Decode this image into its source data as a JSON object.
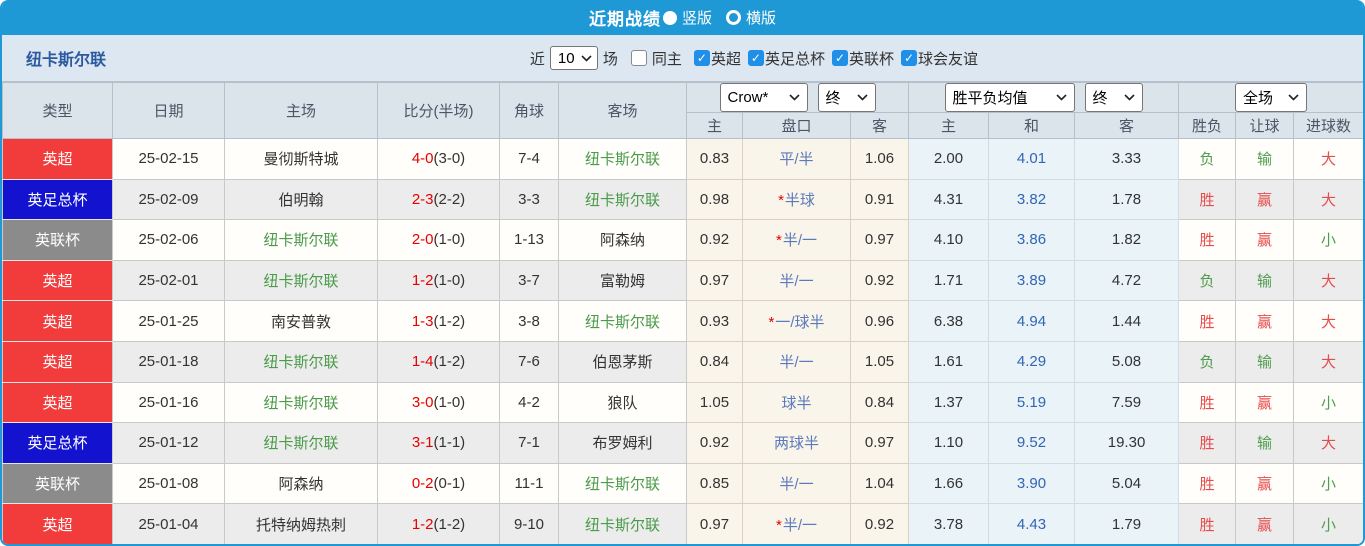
{
  "colors": {
    "accent": "#1f98d6",
    "filter-bg": "#dde7f1",
    "header-bg": "#dce4eb",
    "check-blue": "#1f8fe8",
    "team-link": "#2c5aa0",
    "newcastle-green": "#4a9b4a",
    "score-red": "#e60000",
    "handicap-blue": "#5b79bb",
    "draw-blue": "#3265b4",
    "crow-bg": "#faf5eb",
    "avg-bg": "#e9f3f8",
    "row-odd-bg": "#fffefa",
    "row-even-bg": "#ececec"
  },
  "titlebar": {
    "title": "近期战绩",
    "radio_vertical": "竖版",
    "radio_horizontal": "横版"
  },
  "filterbar": {
    "team": "纽卡斯尔联",
    "recent_label": "近",
    "recent_value": "10",
    "matches_label": "场",
    "same_home_label": "同主",
    "same_home_checked": false,
    "leagues": [
      {
        "label": "英超",
        "checked": true
      },
      {
        "label": "英足总杯",
        "checked": true
      },
      {
        "label": "英联杯",
        "checked": true
      },
      {
        "label": "球会友谊",
        "checked": true
      }
    ]
  },
  "table": {
    "selects": {
      "odds_company": "Crow*",
      "odds_time": "终",
      "avg_type": "胜平负均值",
      "avg_time": "终",
      "scope": "全场"
    },
    "headers": {
      "type": "类型",
      "date": "日期",
      "home": "主场",
      "score": "比分(半场)",
      "corner": "角球",
      "away": "客场",
      "odds_home": "主",
      "handicap": "盘口",
      "odds_away": "客",
      "avg_home": "主",
      "avg_draw": "和",
      "avg_away": "客",
      "result": "胜负",
      "handicap_result": "让球",
      "goals": "进球数"
    },
    "badge_colors": {
      "英超": "#f23c3c",
      "英足总杯": "#1313cf",
      "英联杯": "#8b8b8b"
    },
    "result_color_map": {
      "胜": "#e64c4c",
      "负": "#4e9d4e",
      "赢": "#e64c4c",
      "输": "#4e9d4e",
      "大": "#e64c4c",
      "小": "#4e9d4e"
    },
    "rows": [
      {
        "type": "英超",
        "date": "25-02-15",
        "home": "曼彻斯特城",
        "score": "4-0",
        "half": "(3-0)",
        "corner": "7-4",
        "away": "纽卡斯尔联",
        "odds_home": "0.83",
        "handicap_star": false,
        "handicap": "平/半",
        "odds_away": "1.06",
        "avg_home": "2.00",
        "avg_draw": "4.01",
        "avg_away": "3.33",
        "result": "负",
        "handicap_result": "输",
        "goals": "大"
      },
      {
        "type": "英足总杯",
        "date": "25-02-09",
        "home": "伯明翰",
        "score": "2-3",
        "half": "(2-2)",
        "corner": "3-3",
        "away": "纽卡斯尔联",
        "odds_home": "0.98",
        "handicap_star": true,
        "handicap": "半球",
        "odds_away": "0.91",
        "avg_home": "4.31",
        "avg_draw": "3.82",
        "avg_away": "1.78",
        "result": "胜",
        "handicap_result": "赢",
        "goals": "大"
      },
      {
        "type": "英联杯",
        "date": "25-02-06",
        "home": "纽卡斯尔联",
        "score": "2-0",
        "half": "(1-0)",
        "corner": "1-13",
        "away": "阿森纳",
        "odds_home": "0.92",
        "handicap_star": true,
        "handicap": "半/一",
        "odds_away": "0.97",
        "avg_home": "4.10",
        "avg_draw": "3.86",
        "avg_away": "1.82",
        "result": "胜",
        "handicap_result": "赢",
        "goals": "小"
      },
      {
        "type": "英超",
        "date": "25-02-01",
        "home": "纽卡斯尔联",
        "score": "1-2",
        "half": "(1-0)",
        "corner": "3-7",
        "away": "富勒姆",
        "odds_home": "0.97",
        "handicap_star": false,
        "handicap": "半/一",
        "odds_away": "0.92",
        "avg_home": "1.71",
        "avg_draw": "3.89",
        "avg_away": "4.72",
        "result": "负",
        "handicap_result": "输",
        "goals": "大"
      },
      {
        "type": "英超",
        "date": "25-01-25",
        "home": "南安普敦",
        "score": "1-3",
        "half": "(1-2)",
        "corner": "3-8",
        "away": "纽卡斯尔联",
        "odds_home": "0.93",
        "handicap_star": true,
        "handicap": "一/球半",
        "odds_away": "0.96",
        "avg_home": "6.38",
        "avg_draw": "4.94",
        "avg_away": "1.44",
        "result": "胜",
        "handicap_result": "赢",
        "goals": "大"
      },
      {
        "type": "英超",
        "date": "25-01-18",
        "home": "纽卡斯尔联",
        "score": "1-4",
        "half": "(1-2)",
        "corner": "7-6",
        "away": "伯恩茅斯",
        "odds_home": "0.84",
        "handicap_star": false,
        "handicap": "半/一",
        "odds_away": "1.05",
        "avg_home": "1.61",
        "avg_draw": "4.29",
        "avg_away": "5.08",
        "result": "负",
        "handicap_result": "输",
        "goals": "大"
      },
      {
        "type": "英超",
        "date": "25-01-16",
        "home": "纽卡斯尔联",
        "score": "3-0",
        "half": "(1-0)",
        "corner": "4-2",
        "away": "狼队",
        "odds_home": "1.05",
        "handicap_star": false,
        "handicap": "球半",
        "odds_away": "0.84",
        "avg_home": "1.37",
        "avg_draw": "5.19",
        "avg_away": "7.59",
        "result": "胜",
        "handicap_result": "赢",
        "goals": "小"
      },
      {
        "type": "英足总杯",
        "date": "25-01-12",
        "home": "纽卡斯尔联",
        "score": "3-1",
        "half": "(1-1)",
        "corner": "7-1",
        "away": "布罗姆利",
        "odds_home": "0.92",
        "handicap_star": false,
        "handicap": "两球半",
        "odds_away": "0.97",
        "avg_home": "1.10",
        "avg_draw": "9.52",
        "avg_away": "19.30",
        "result": "胜",
        "handicap_result": "输",
        "goals": "大"
      },
      {
        "type": "英联杯",
        "date": "25-01-08",
        "home": "阿森纳",
        "score": "0-2",
        "half": "(0-1)",
        "corner": "11-1",
        "away": "纽卡斯尔联",
        "odds_home": "0.85",
        "handicap_star": false,
        "handicap": "半/一",
        "odds_away": "1.04",
        "avg_home": "1.66",
        "avg_draw": "3.90",
        "avg_away": "5.04",
        "result": "胜",
        "handicap_result": "赢",
        "goals": "小"
      },
      {
        "type": "英超",
        "date": "25-01-04",
        "home": "托特纳姆热刺",
        "score": "1-2",
        "half": "(1-2)",
        "corner": "9-10",
        "away": "纽卡斯尔联",
        "odds_home": "0.97",
        "handicap_star": true,
        "handicap": "半/一",
        "odds_away": "0.92",
        "avg_home": "3.78",
        "avg_draw": "4.43",
        "avg_away": "1.79",
        "result": "胜",
        "handicap_result": "赢",
        "goals": "小"
      }
    ]
  }
}
